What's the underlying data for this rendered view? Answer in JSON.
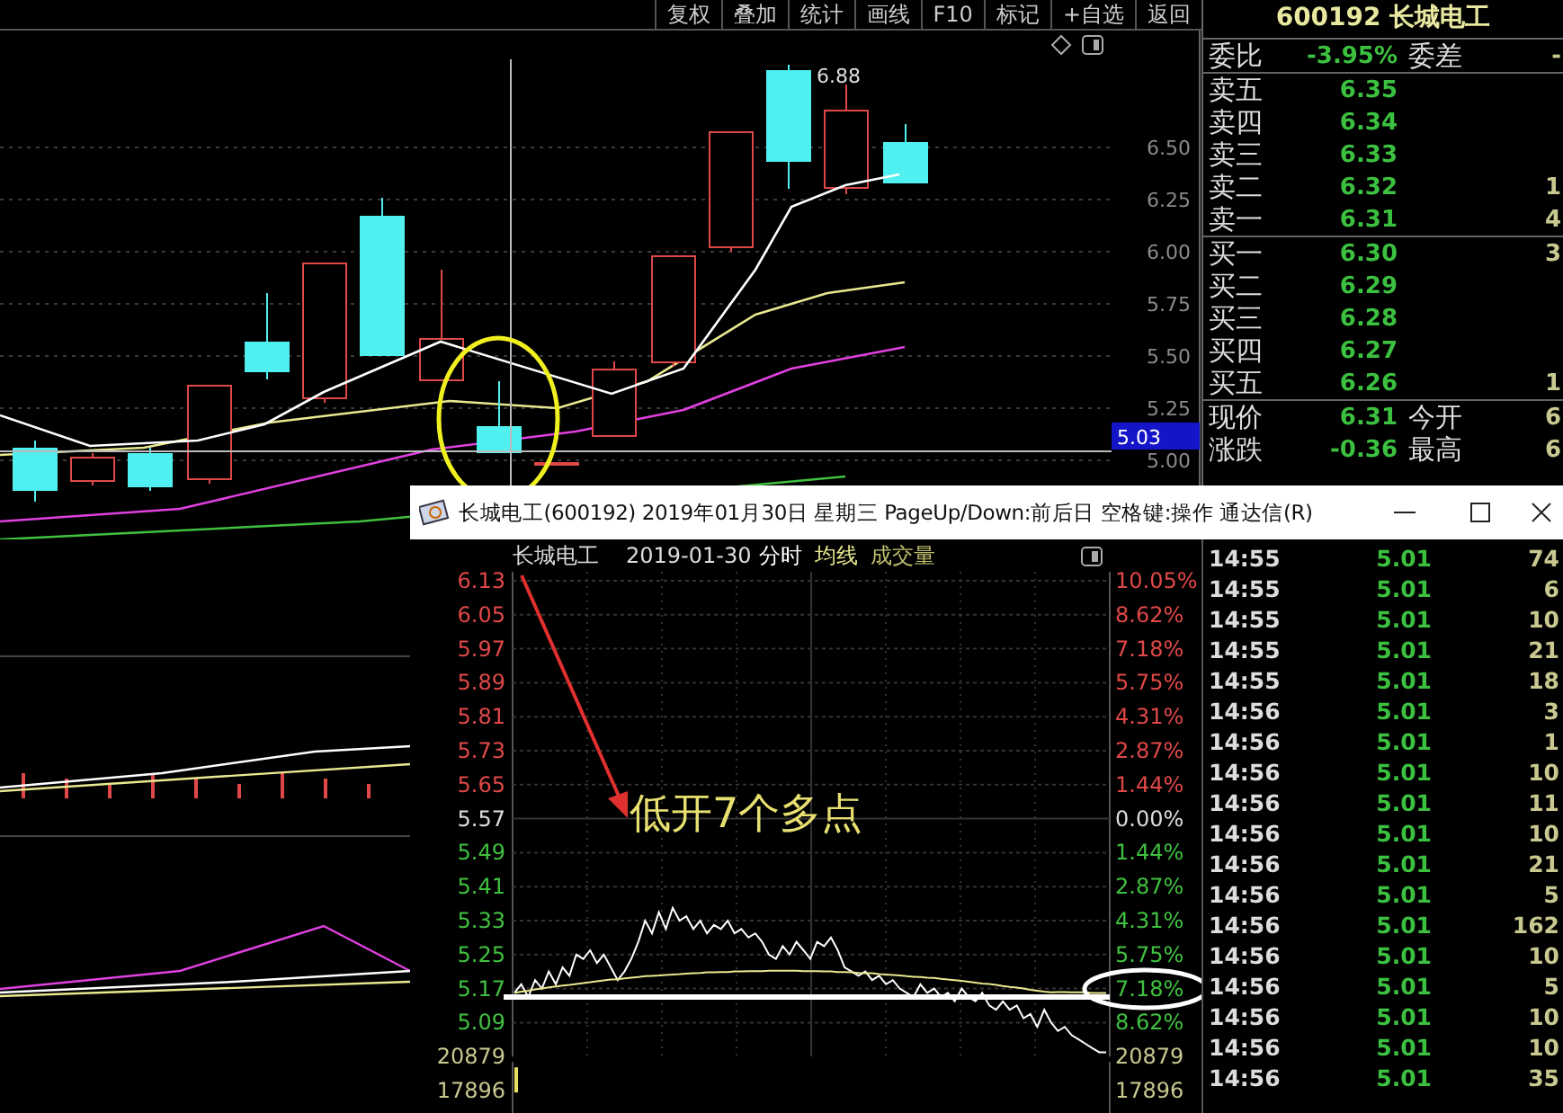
{
  "toolbar": {
    "buttons": [
      "复权",
      "叠加",
      "统计",
      "画线",
      "F10",
      "标记",
      "+自选",
      "返回"
    ]
  },
  "main_chart": {
    "price_ticks": [
      "6.50",
      "6.25",
      "6.00",
      "5.75",
      "5.50",
      "5.25",
      "5.00"
    ],
    "crosshair_price": "5.03",
    "high_label": "6.88"
  },
  "quote_panel": {
    "title": "600192 长城电工",
    "ratio": {
      "label": "委比",
      "value": "-3.95%",
      "label_2": "委差",
      "value_2": "-"
    },
    "asks": [
      {
        "label": "卖五",
        "price": "6.35"
      },
      {
        "label": "卖四",
        "price": "6.34"
      },
      {
        "label": "卖三",
        "price": "6.33"
      },
      {
        "label": "卖二",
        "price": "6.32",
        "volume": "1"
      },
      {
        "label": "卖一",
        "price": "6.31",
        "volume": "4"
      }
    ],
    "bids": [
      {
        "label": "买一",
        "price": "6.30",
        "volume": "3"
      },
      {
        "label": "买二",
        "price": "6.29"
      },
      {
        "label": "买三",
        "price": "6.28"
      },
      {
        "label": "买四",
        "price": "6.27"
      },
      {
        "label": "买五",
        "price": "6.26",
        "volume": "1"
      }
    ],
    "stats": [
      {
        "label": "现价",
        "value": "6.31",
        "label_2": "今开",
        "value_2": "6"
      },
      {
        "label": "涨跌",
        "value": "-0.36",
        "label_2": "最高",
        "value_2": "6"
      }
    ]
  },
  "popup": {
    "title": "长城电工(600192) 2019年01月30日 星期三 PageUp/Down:前后日 空格键:操作 通达信(R)",
    "header": {
      "name": "长城电工",
      "date": "2019-01-30",
      "volume": "成交量"
    },
    "volume_axis": [
      "20879",
      "17896"
    ],
    "percent_axis": [
      {
        "text": "10.05%",
        "kind": "up"
      },
      {
        "text": "8.62%",
        "kind": "up"
      },
      {
        "text": "7.18%",
        "kind": "up"
      },
      {
        "text": "5.75%",
        "kind": "up"
      },
      {
        "text": "4.31%",
        "kind": "up"
      },
      {
        "text": "2.87%",
        "kind": "up"
      },
      {
        "text": "1.44%",
        "kind": "up"
      },
      {
        "text": "0.00%",
        "kind": "flat"
      },
      {
        "text": "1.44%",
        "kind": "down"
      },
      {
        "text": "2.87%",
        "kind": "down"
      },
      {
        "text": "4.31%",
        "kind": "down"
      },
      {
        "text": "5.75%",
        "kind": "down"
      },
      {
        "text": "7.18%",
        "kind": "down"
      },
      {
        "text": "8.62%",
        "kind": "down"
      },
      {
        "text": "20879",
        "kind": "volume"
      },
      {
        "text": "17896",
        "kind": "volume"
      }
    ],
    "annotation": "低开7个多点",
    "chart_data": {
      "type": "line",
      "grid": true,
      "categories": [
        null,
        null,
        null,
        null,
        null,
        null,
        null,
        null,
        null,
        null,
        null,
        null,
        null,
        null,
        null,
        null,
        null,
        null,
        null,
        null,
        null,
        null,
        null,
        null,
        null,
        null,
        null,
        null,
        null,
        null,
        null,
        null,
        null,
        null,
        null,
        null,
        null,
        null,
        null,
        null,
        null,
        null,
        null,
        null,
        null,
        null,
        null,
        null,
        null,
        null,
        null,
        null,
        null,
        null,
        null,
        null,
        null,
        null,
        null,
        null,
        null,
        null,
        null,
        null,
        null,
        null,
        null,
        null,
        null,
        null,
        null,
        null,
        null,
        null,
        null,
        null,
        null,
        null,
        null,
        null,
        null,
        null,
        null,
        null,
        null,
        null,
        null
      ],
      "ylim": [
        5.01,
        6.13
      ],
      "yticks": [
        {
          "value": 6.13,
          "label": "6.13"
        },
        {
          "value": 6.05,
          "label": "6.05"
        },
        {
          "value": 5.97,
          "label": "5.97"
        },
        {
          "value": 5.89,
          "label": "5.89"
        },
        {
          "value": 5.81,
          "label": "5.81"
        },
        {
          "value": 5.73,
          "label": "5.73"
        },
        {
          "value": 5.65,
          "label": "5.65"
        },
        {
          "value": 5.57,
          "label": "5.57"
        },
        {
          "value": 5.49,
          "label": "5.49"
        },
        {
          "value": 5.41,
          "label": "5.41"
        },
        {
          "value": 5.33,
          "label": "5.33"
        },
        {
          "value": 5.25,
          "label": "5.25"
        },
        {
          "value": 5.17,
          "label": "5.17"
        },
        {
          "value": 5.09,
          "label": "5.09"
        }
      ],
      "series": [
        {
          "name": "分时",
          "color": "#ffffff",
          "values": [
            5.16,
            5.18,
            5.15,
            5.19,
            5.17,
            5.21,
            5.18,
            5.22,
            5.2,
            5.25,
            5.24,
            5.26,
            5.23,
            5.25,
            5.22,
            5.19,
            5.21,
            5.24,
            5.28,
            5.33,
            5.3,
            5.35,
            5.31,
            5.36,
            5.33,
            5.34,
            5.31,
            5.33,
            5.3,
            5.32,
            5.31,
            5.33,
            5.3,
            5.31,
            5.29,
            5.3,
            5.28,
            5.25,
            5.24,
            5.27,
            5.25,
            5.28,
            5.26,
            5.24,
            5.28,
            5.27,
            5.29,
            5.26,
            5.22,
            5.21,
            5.2,
            5.21,
            5.19,
            5.2,
            5.18,
            5.19,
            5.17,
            5.16,
            5.15,
            5.18,
            5.16,
            5.17,
            5.15,
            5.16,
            5.14,
            5.17,
            5.15,
            5.14,
            5.16,
            5.13,
            5.12,
            5.14,
            5.12,
            5.13,
            5.1,
            5.11,
            5.08,
            5.12,
            5.09,
            5.07,
            5.08,
            5.06,
            5.05,
            5.04,
            5.03,
            5.02,
            5.02
          ]
        },
        {
          "name": "均线",
          "color": "#e8e890",
          "values": [
            5.16,
            5.163,
            5.165,
            5.168,
            5.17,
            5.173,
            5.175,
            5.177,
            5.179,
            5.181,
            5.183,
            5.185,
            5.187,
            5.189,
            5.191,
            5.192,
            5.194,
            5.196,
            5.197,
            5.199,
            5.2,
            5.201,
            5.202,
            5.203,
            5.204,
            5.205,
            5.206,
            5.207,
            5.208,
            5.208,
            5.209,
            5.209,
            5.21,
            5.21,
            5.211,
            5.211,
            5.211,
            5.212,
            5.212,
            5.212,
            5.212,
            5.212,
            5.211,
            5.211,
            5.211,
            5.21,
            5.21,
            5.209,
            5.209,
            5.208,
            5.207,
            5.206,
            5.206,
            5.204,
            5.203,
            5.202,
            5.201,
            5.199,
            5.198,
            5.197,
            5.196,
            5.195,
            5.193,
            5.191,
            5.19,
            5.188,
            5.186,
            5.184,
            5.182,
            5.181,
            5.179,
            5.176,
            5.174,
            5.172,
            5.17,
            5.167,
            5.165,
            5.163,
            5.161,
            5.162,
            5.162,
            5.161,
            5.161,
            5.161,
            5.16,
            5.16,
            5.16
          ]
        }
      ]
    },
    "ticks": [
      {
        "time": "14:55",
        "price": "5.01",
        "volume": "74"
      },
      {
        "time": "14:55",
        "price": "5.01",
        "volume": "6"
      },
      {
        "time": "14:55",
        "price": "5.01",
        "volume": "10"
      },
      {
        "time": "14:55",
        "price": "5.01",
        "volume": "21"
      },
      {
        "time": "14:55",
        "price": "5.01",
        "volume": "18"
      },
      {
        "time": "14:56",
        "price": "5.01",
        "volume": "3"
      },
      {
        "time": "14:56",
        "price": "5.01",
        "volume": "1"
      },
      {
        "time": "14:56",
        "price": "5.01",
        "volume": "10"
      },
      {
        "time": "14:56",
        "price": "5.01",
        "volume": "11"
      },
      {
        "time": "14:56",
        "price": "5.01",
        "volume": "10"
      },
      {
        "time": "14:56",
        "price": "5.01",
        "volume": "21"
      },
      {
        "time": "14:56",
        "price": "5.01",
        "volume": "5"
      },
      {
        "time": "14:56",
        "price": "5.01",
        "volume": "162"
      },
      {
        "time": "14:56",
        "price": "5.01",
        "volume": "10"
      },
      {
        "time": "14:56",
        "price": "5.01",
        "volume": "5"
      },
      {
        "time": "14:56",
        "price": "5.01",
        "volume": "10"
      },
      {
        "time": "14:56",
        "price": "5.01",
        "volume": "10"
      },
      {
        "time": "14:56",
        "price": "5.01",
        "volume": "35"
      }
    ]
  }
}
